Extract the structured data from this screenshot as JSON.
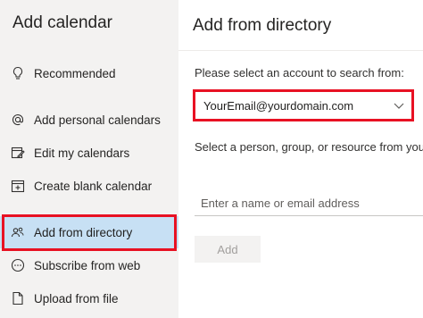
{
  "sidebar": {
    "title": "Add calendar",
    "items": [
      {
        "label": "Recommended",
        "icon": "lightbulb-icon"
      },
      {
        "label": "Add personal calendars",
        "icon": "at-sign-icon"
      },
      {
        "label": "Edit my calendars",
        "icon": "edit-calendar-icon"
      },
      {
        "label": "Create blank calendar",
        "icon": "calendar-add-icon"
      },
      {
        "label": "Add from directory",
        "icon": "people-icon"
      },
      {
        "label": "Subscribe from web",
        "icon": "globe-icon"
      },
      {
        "label": "Upload from file",
        "icon": "file-icon"
      }
    ],
    "active_index": 4
  },
  "main": {
    "title": "Add from directory",
    "account_prompt": "Please select an account to search from:",
    "account_value": "YourEmail@yourdomain.com",
    "select_description": "Select a person, group, or resource from your organization's directory.",
    "search_placeholder": "Enter a name or email address",
    "add_button": "Add"
  },
  "colors": {
    "highlight": "#e81123",
    "active_item_bg": "#c7e0f4",
    "sidebar_bg": "#f3f2f1"
  }
}
